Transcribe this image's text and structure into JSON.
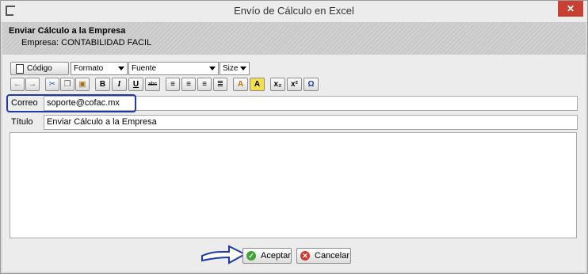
{
  "window": {
    "title": "Envío de Cálculo en Excel",
    "close_label": "✕"
  },
  "header": {
    "title": "Enviar Cálculo a la Empresa",
    "subtitle": "Empresa: CONTABILIDAD FACIL"
  },
  "toolbar": {
    "code_label": "Código",
    "format_select": "Formato",
    "font_select": "Fuente",
    "size_select": "Size",
    "bold": "B",
    "italic": "I",
    "underline": "U",
    "strike": "abc",
    "subscript": "x₂",
    "superscript": "x²",
    "special_char": "Ω",
    "text_color": "A",
    "bg_color": "A"
  },
  "form": {
    "to_label": "Correo",
    "to_value": "soporte@cofac.mx",
    "subject_label": "Título",
    "subject_value": "Enviar Cálculo a la Empresa"
  },
  "buttons": {
    "accept": "Aceptar",
    "cancel": "Cancelar"
  },
  "colors": {
    "highlight": "#1d3aa8",
    "close": "#c84031",
    "accept_icon": "#3fa535",
    "cancel_icon": "#d0392b"
  }
}
